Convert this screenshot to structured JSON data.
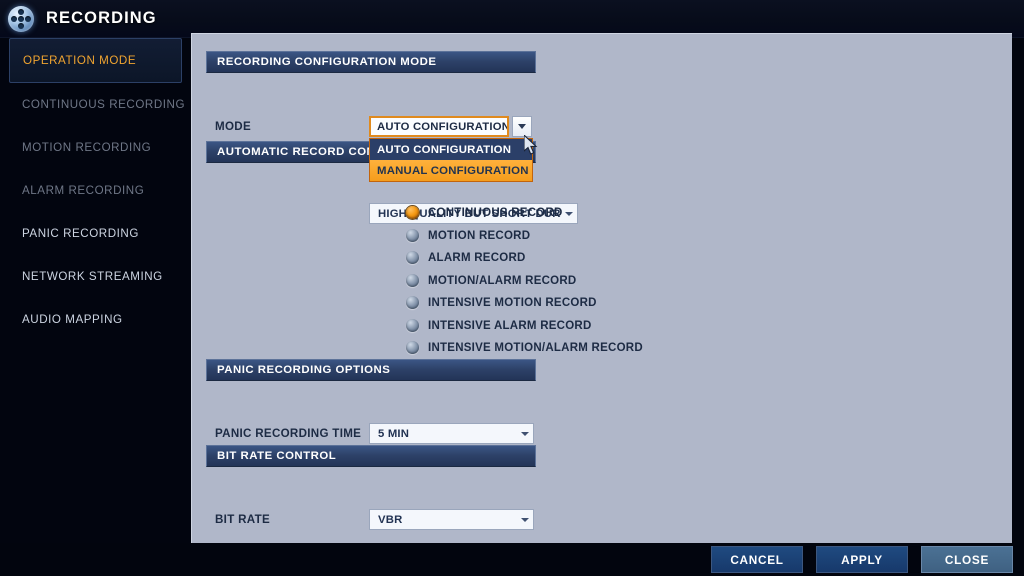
{
  "window": {
    "title": "RECORDING",
    "icon": "film-reel-icon"
  },
  "sidebar": {
    "items": [
      {
        "label": "OPERATION MODE",
        "state": "active"
      },
      {
        "label": "CONTINUOUS RECORDING",
        "state": "dim"
      },
      {
        "label": "MOTION RECORDING",
        "state": "dim"
      },
      {
        "label": "ALARM RECORDING",
        "state": "dim"
      },
      {
        "label": "PANIC RECORDING",
        "state": "bright"
      },
      {
        "label": "NETWORK STREAMING",
        "state": "bright"
      },
      {
        "label": "AUDIO MAPPING",
        "state": "bright"
      }
    ]
  },
  "sections": {
    "recording_config_mode": {
      "title": "RECORDING CONFIGURATION MODE",
      "mode_label": "MODE",
      "mode_value": "AUTO CONFIGURATION",
      "dropdown_open": true,
      "options": [
        {
          "label": "AUTO CONFIGURATION",
          "highlighted": false
        },
        {
          "label": "MANUAL CONFIGURATION",
          "highlighted": true
        }
      ]
    },
    "automatic_record_config": {
      "title": "AUTOMATIC RECORD CONFIGURATION MODE",
      "quality_value": "HIGH QUALITY BUT SHORT DURA...",
      "radios": [
        {
          "label": "CONTINUOUS RECORD",
          "selected": true
        },
        {
          "label": "MOTION RECORD",
          "selected": false
        },
        {
          "label": "ALARM RECORD",
          "selected": false
        },
        {
          "label": "MOTION/ALARM RECORD",
          "selected": false
        },
        {
          "label": "INTENSIVE MOTION RECORD",
          "selected": false
        },
        {
          "label": "INTENSIVE ALARM RECORD",
          "selected": false
        },
        {
          "label": "INTENSIVE MOTION/ALARM RECORD",
          "selected": false
        }
      ]
    },
    "panic_recording_options": {
      "title": "PANIC RECORDING OPTIONS",
      "time_label": "PANIC RECORDING TIME",
      "time_value": "5 MIN"
    },
    "bit_rate_control": {
      "title": "BIT RATE CONTROL",
      "rate_label": "BIT RATE",
      "rate_value": "VBR"
    }
  },
  "footer": {
    "cancel": "CANCEL",
    "apply": "APPLY",
    "close": "CLOSE"
  },
  "colors": {
    "accent_orange": "#f0a430",
    "panel_bg": "#b0b7c9",
    "section_header": "#2d4168",
    "window_bg": "#02050e",
    "button_dark": "#1f4a80",
    "button_light": "#4b7194"
  }
}
